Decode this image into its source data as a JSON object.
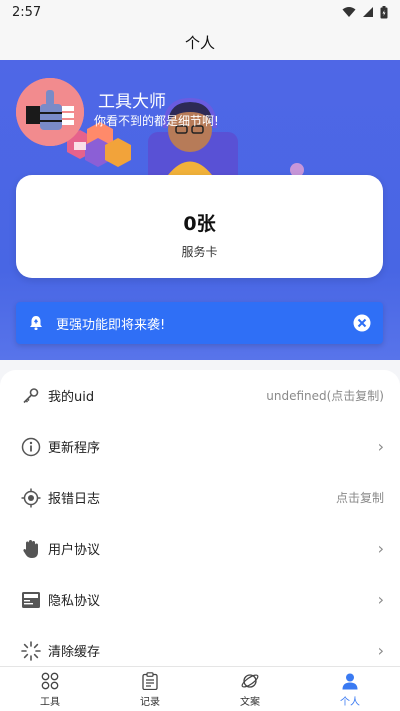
{
  "status": {
    "time": "2:57"
  },
  "nav": {
    "title": "个人"
  },
  "profile": {
    "name": "工具大师",
    "tagline": "你看不到的都是细节啊!"
  },
  "card": {
    "count": "0张",
    "label": "服务卡"
  },
  "notice": {
    "text": "更强功能即将来袭!"
  },
  "menu": {
    "items": [
      {
        "label": "我的uid",
        "value": "undefined(点击复制)",
        "icon": "key-icon"
      },
      {
        "label": "更新程序",
        "value": "",
        "icon": "info-icon"
      },
      {
        "label": "报错日志",
        "value": "点击复制",
        "icon": "target-icon"
      },
      {
        "label": "用户协议",
        "value": "",
        "icon": "hand-icon"
      },
      {
        "label": "隐私协议",
        "value": "",
        "icon": "document-icon"
      },
      {
        "label": "清除缓存",
        "value": "",
        "icon": "spinner-icon"
      }
    ]
  },
  "tabs": [
    {
      "label": "工具",
      "icon": "grid-icon",
      "active": false
    },
    {
      "label": "记录",
      "icon": "clipboard-icon",
      "active": false
    },
    {
      "label": "文案",
      "icon": "planet-icon",
      "active": false
    },
    {
      "label": "个人",
      "icon": "person-icon",
      "active": true
    }
  ],
  "colors": {
    "primary": "#3a7af2",
    "hero": "#4f67e6",
    "notice": "#2f6ff6"
  }
}
